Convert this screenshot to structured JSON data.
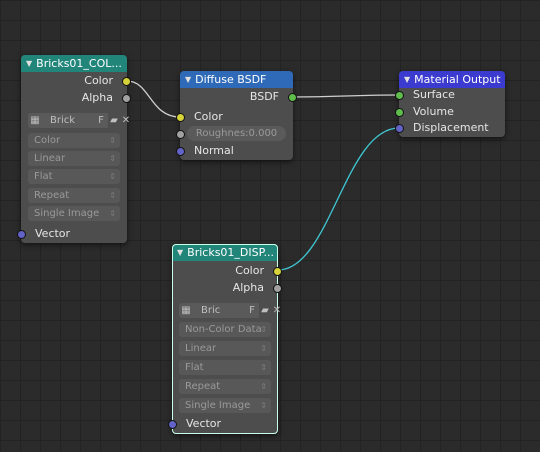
{
  "nodes": {
    "image_color": {
      "title": "Bricks01_COL...",
      "outputs": [
        "Color",
        "Alpha"
      ],
      "image_name": "Brick",
      "image_field": "F",
      "color_space": "Color",
      "interpolation": "Linear",
      "projection": "Flat",
      "extension": "Repeat",
      "source": "Single Image",
      "input": "Vector"
    },
    "diffuse": {
      "title": "Diffuse BSDF",
      "output": "BSDF",
      "inputs": {
        "color": "Color",
        "roughness": "Roughnes:0.000",
        "normal": "Normal"
      }
    },
    "material_output": {
      "title": "Material Output",
      "inputs": [
        "Surface",
        "Volume",
        "Displacement"
      ]
    },
    "image_disp": {
      "title": "Bricks01_DISP...",
      "outputs": [
        "Color",
        "Alpha"
      ],
      "image_name": "Bric",
      "image_field": "F",
      "color_space": "Non-Color Data",
      "interpolation": "Linear",
      "projection": "Flat",
      "extension": "Repeat",
      "source": "Single Image",
      "input": "Vector"
    }
  },
  "icons": {
    "collapse": "triangle-down-icon",
    "image": "image-icon",
    "folder": "folder-icon",
    "close": "close-icon"
  },
  "colors": {
    "background": "#2b2b2b",
    "node_body": "#4d4d4d",
    "header_image": "#21857a",
    "header_shader": "#2e6ab7",
    "header_output": "#3b3bd0",
    "socket_color": "#d6d23a",
    "socket_float": "#a1a1a1",
    "socket_shader": "#5fbd4c",
    "socket_vector": "#6363c7",
    "wire": "#cfcfcf",
    "wire_selected": "#3fc7d2"
  }
}
